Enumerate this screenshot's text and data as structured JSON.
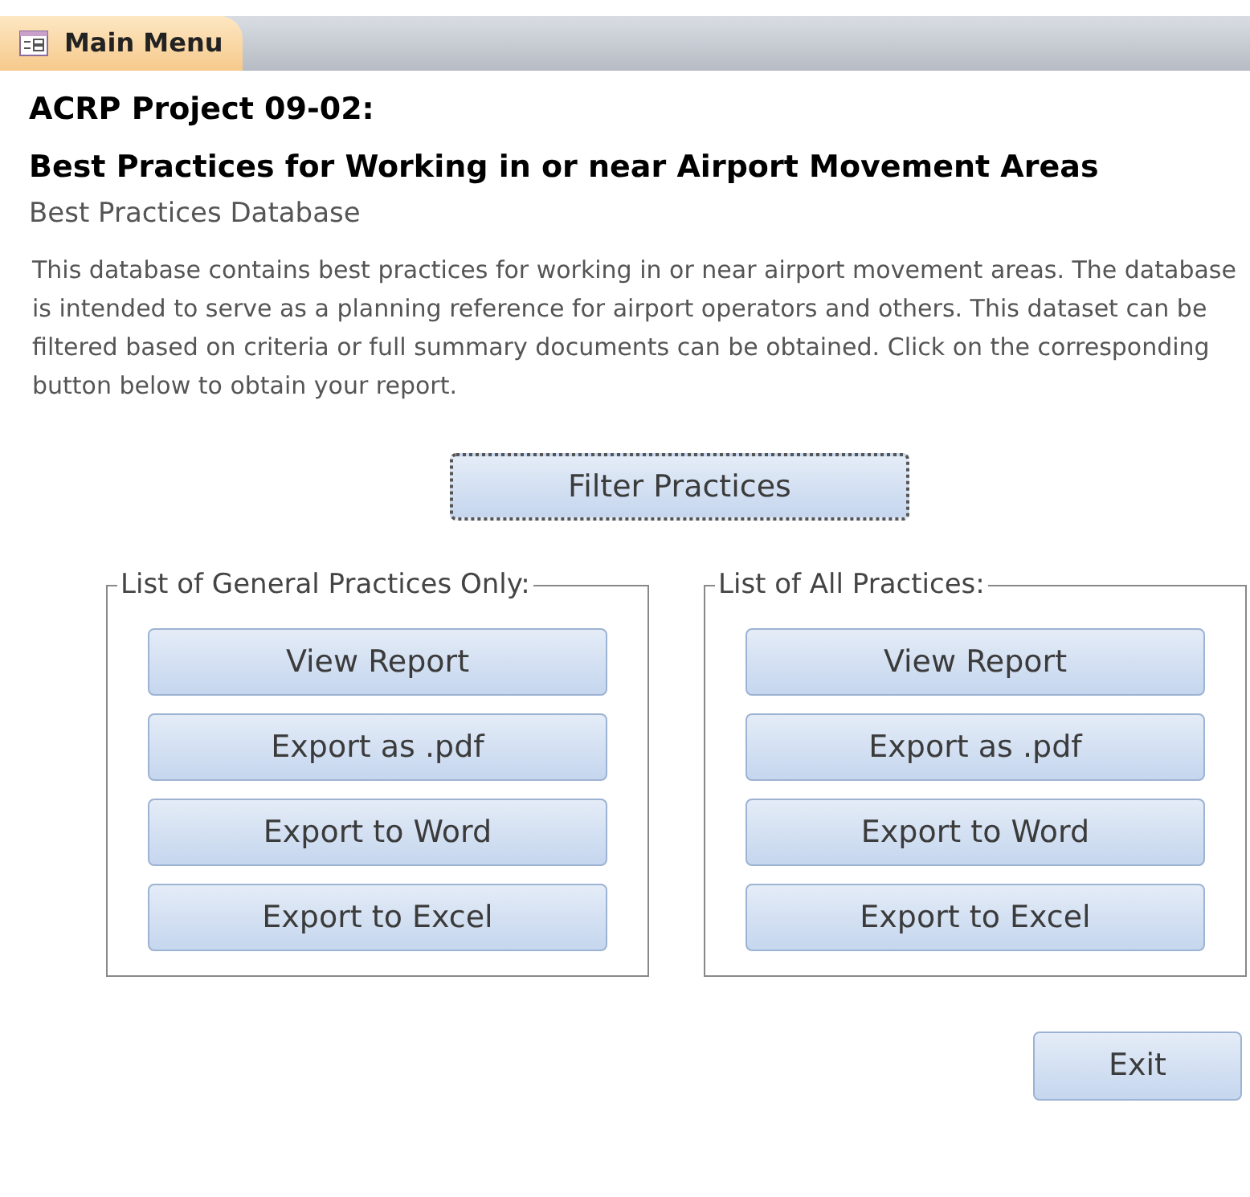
{
  "tab": {
    "label": "Main Menu",
    "selected": true
  },
  "title_lines": [
    "ACRP Project 09-02:",
    "Best Practices for Working in or near Airport Movement Areas"
  ],
  "subtitle": "Best Practices Database",
  "description": "This database contains best practices for working in or near airport movement areas.  The database is intended to serve as a planning reference for airport operators and others.  This dataset can be filtered based on criteria or full summary documents can be obtained.  Click on the corresponding button below to obtain your report.",
  "filter_button": {
    "label": "Filter Practices",
    "focused": true
  },
  "groups": [
    {
      "title": "List of General Practices Only:",
      "buttons": [
        "View Report",
        "Export as .pdf",
        "Export to Word",
        "Export to Excel"
      ]
    },
    {
      "title": "List of All Practices:",
      "buttons": [
        "View Report",
        "Export as .pdf",
        "Export to Word",
        "Export to Excel"
      ]
    }
  ],
  "exit_button": {
    "label": "Exit"
  }
}
